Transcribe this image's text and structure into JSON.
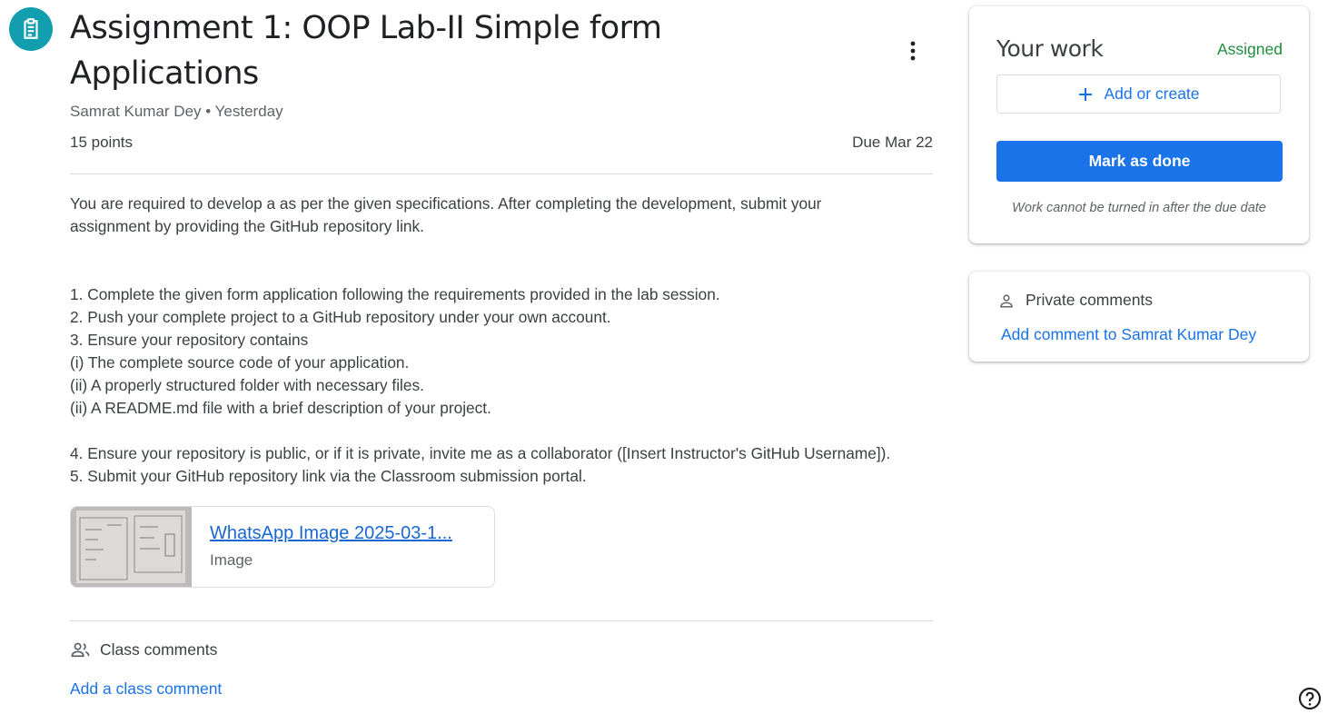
{
  "assignment": {
    "icon": "assignment-icon",
    "title": "Assignment 1: OOP Lab-II Simple form Applications",
    "author": "Samrat Kumar Dey",
    "posted": "Yesterday",
    "meta_line": "Samrat Kumar Dey • Yesterday",
    "points": "15 points",
    "due": "Due Mar 22",
    "description_lines": [
      "You are required to develop a as per the given specifications. After completing the development, submit your",
      "assignment by providing the GitHub repository link.",
      "",
      "",
      "1. Complete the given form application following the requirements provided in the lab session.",
      "2. Push your complete project to a GitHub repository under your own account.",
      "3. Ensure your repository contains",
      "(i) The complete source code of your application.",
      "(ii) A properly structured folder with necessary files.",
      "(ii) A README.md file with a brief description of your project.",
      "",
      "4. Ensure your repository is public, or if it is private, invite me as a collaborator ([Insert Instructor's GitHub Username]).",
      "5. Submit your GitHub repository link via the Classroom submission portal."
    ],
    "attachment": {
      "title": "WhatsApp Image 2025-03-1...",
      "type": "Image"
    }
  },
  "class_comments": {
    "icon": "people-icon",
    "label": "Class comments",
    "add_label": "Add a class comment"
  },
  "your_work": {
    "title": "Your work",
    "status": "Assigned",
    "status_color": "#1e8e3e",
    "add_create_label": "Add or create",
    "mark_done_label": "Mark as done",
    "late_note": "Work cannot be turned in after the due date"
  },
  "private_comments": {
    "icon": "person-icon",
    "label": "Private comments",
    "add_label": "Add comment to Samrat Kumar Dey"
  },
  "colors": {
    "accent": "#1a73e8",
    "assignment_icon_bg": "#129eaf"
  }
}
